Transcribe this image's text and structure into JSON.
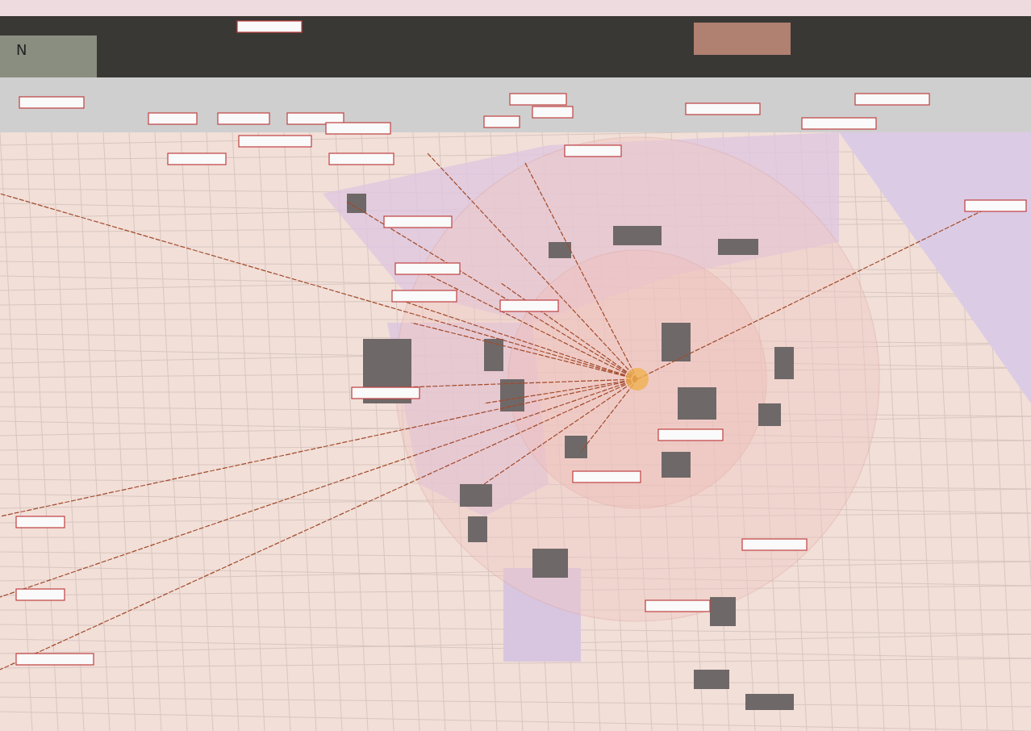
{
  "map": {
    "north_label": "N"
  }
}
